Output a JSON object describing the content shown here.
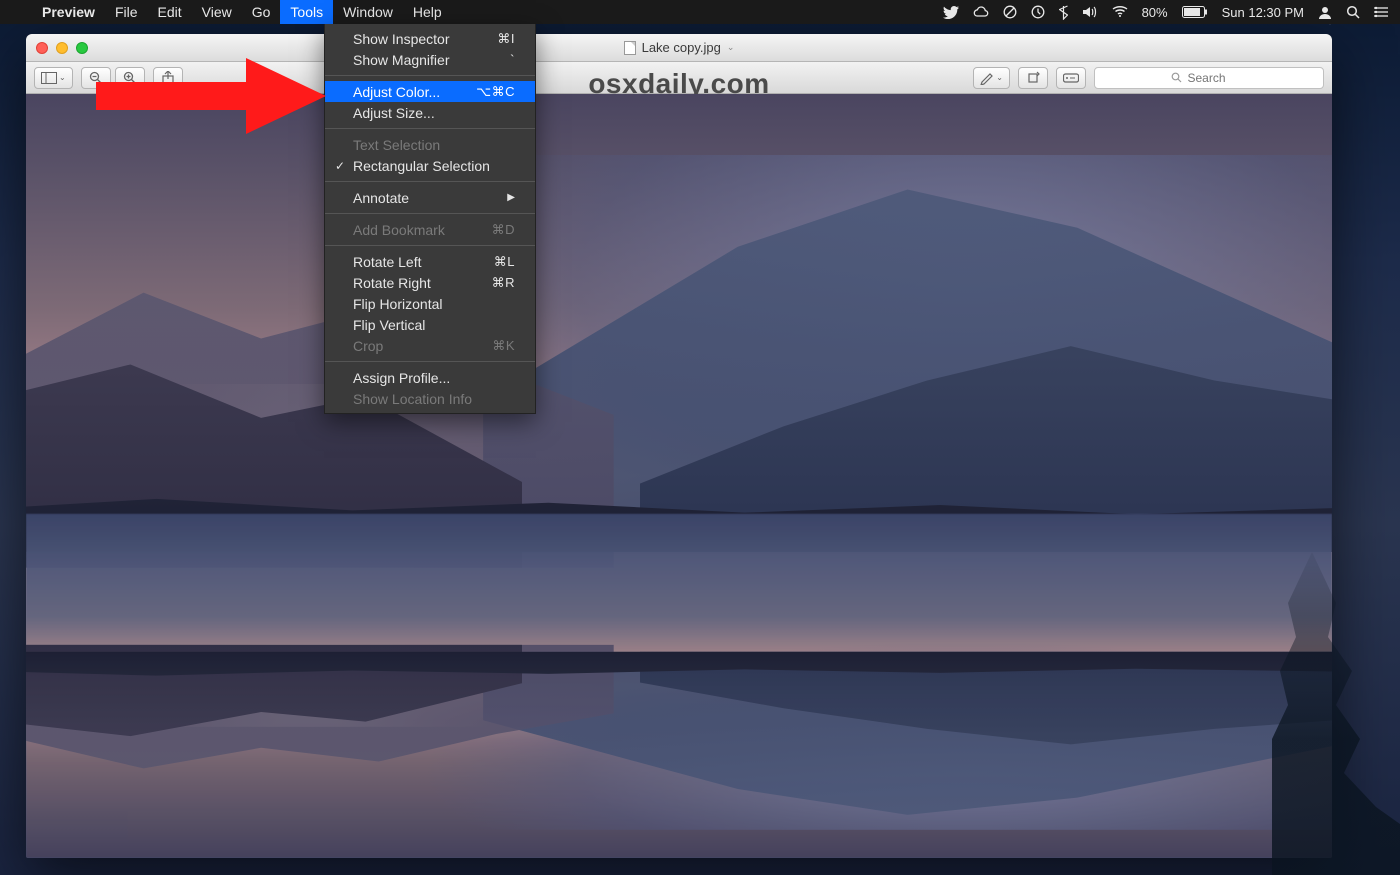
{
  "menubar": {
    "app": "Preview",
    "items": [
      "File",
      "Edit",
      "View",
      "Go",
      "Tools",
      "Window",
      "Help"
    ],
    "active": "Tools",
    "status": {
      "battery_pct": "80%",
      "clock": "Sun 12:30 PM"
    }
  },
  "window": {
    "title": "Lake copy.jpg",
    "search_placeholder": "Search",
    "watermark": "osxdaily.com"
  },
  "dropdown": {
    "groups": [
      [
        {
          "label": "Show Inspector",
          "shortcut": "⌘I"
        },
        {
          "label": "Show Magnifier",
          "shortcut": "`"
        }
      ],
      [
        {
          "label": "Adjust Color...",
          "shortcut": "⌥⌘C",
          "highlight": true
        },
        {
          "label": "Adjust Size...",
          "shortcut": ""
        }
      ],
      [
        {
          "label": "Text Selection",
          "disabled": true
        },
        {
          "label": "Rectangular Selection",
          "checked": true
        }
      ],
      [
        {
          "label": "Annotate",
          "submenu": true
        }
      ],
      [
        {
          "label": "Add Bookmark",
          "shortcut": "⌘D",
          "disabled": true
        }
      ],
      [
        {
          "label": "Rotate Left",
          "shortcut": "⌘L"
        },
        {
          "label": "Rotate Right",
          "shortcut": "⌘R"
        },
        {
          "label": "Flip Horizontal"
        },
        {
          "label": "Flip Vertical"
        },
        {
          "label": "Crop",
          "shortcut": "⌘K",
          "disabled": true
        }
      ],
      [
        {
          "label": "Assign Profile..."
        },
        {
          "label": "Show Location Info",
          "disabled": true
        }
      ]
    ]
  }
}
